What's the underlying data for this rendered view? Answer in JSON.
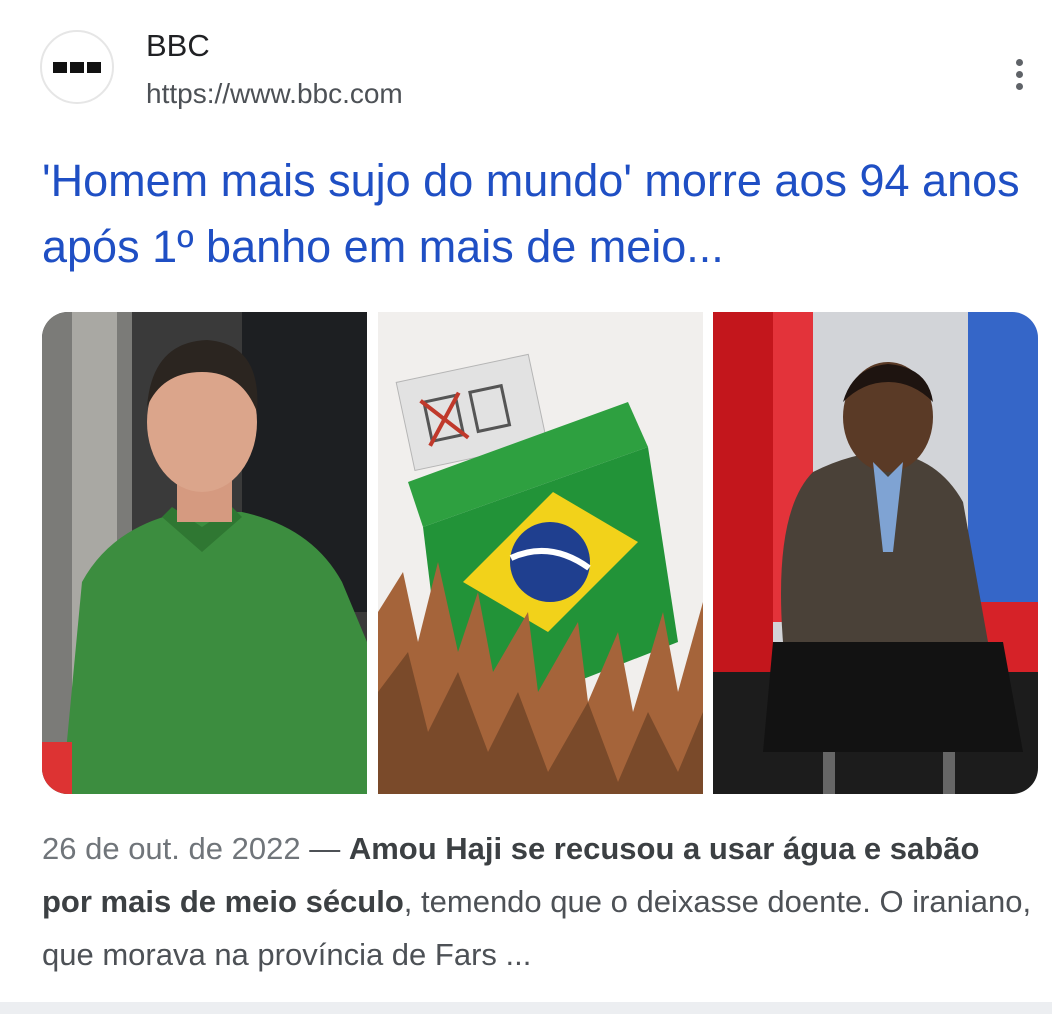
{
  "source": {
    "name": "BBC",
    "url": "https://www.bbc.com",
    "favicon_icon": "bbc-blocks-icon",
    "more_icon": "more-vert-icon"
  },
  "result": {
    "title": "'Homem mais sujo do mundo' morre aos 94 anos após 1º banho em mais de meio...",
    "title_color": "#1f4fc4",
    "images": [
      {
        "subject": "man in green polo shirt"
      },
      {
        "subject": "ballot box with Brazil flag and raised hands"
      },
      {
        "subject": "man in suit seated in TV studio"
      }
    ],
    "snippet": {
      "date": "26 de out. de 2022",
      "separator": " — ",
      "bold_text": "Amou Haji se recusou a usar água e sabão por mais de meio século",
      "rest_text": ", temendo que o deixasse doente. O iraniano, que morava na província de Fars ..."
    }
  }
}
